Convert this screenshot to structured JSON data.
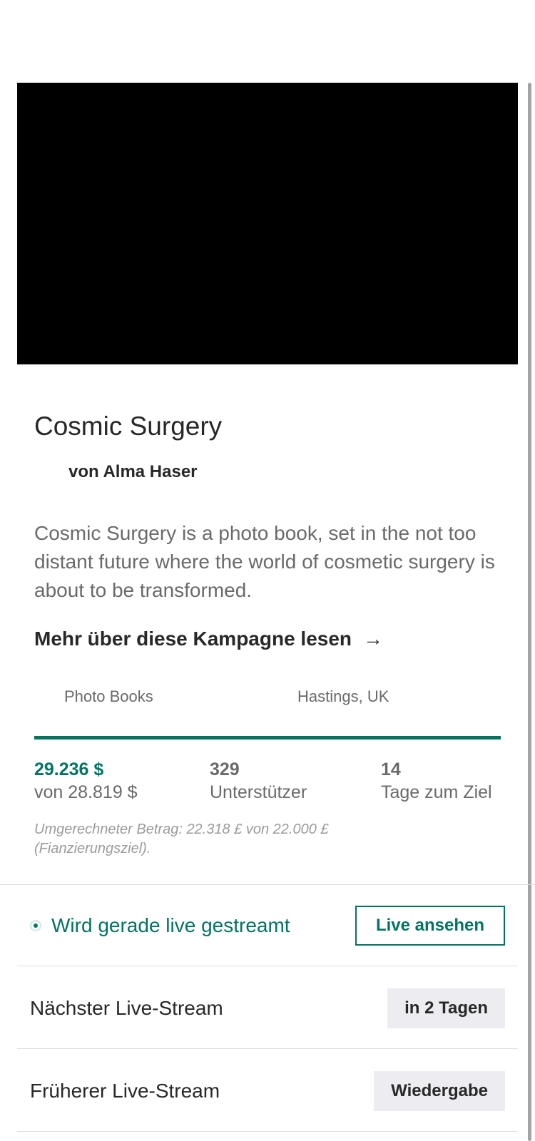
{
  "project": {
    "title": "Cosmic Surgery",
    "creator": "von Alma Haser",
    "blurb": "Cosmic Surgery is a photo book, set in the not too distant future where the world of cosmetic surgery is about to be transformed.",
    "read_more": "Mehr über diese Kampagne lesen",
    "category": "Photo Books",
    "location": "Hastings, UK"
  },
  "funding": {
    "progress_fraction": 1.0,
    "pledged": "29.236 $",
    "goal": "von 28.819 $",
    "backers_count": "329",
    "backers_label": "Unterstützer",
    "days_count": "14",
    "days_label": "Tage zum Ziel",
    "converted_note": "Umgerechneter Betrag: 22.318 £ von 22.000 £ (Fianzierungsziel)."
  },
  "live": {
    "now_status": "Wird gerade live gestreamt",
    "watch_button": "Live ansehen",
    "next_label": "Nächster Live-Stream",
    "next_value": "in 2 Tagen",
    "past_label": "Früherer Live-Stream",
    "past_button": "Wiedergabe"
  },
  "icons": {
    "read_more_arrow": "arrow-right-icon",
    "live_indicator": "live-dot-icon"
  },
  "colors": {
    "accent": "#037362",
    "text": "#282828",
    "muted": "#6a6a6a",
    "pill_bg": "#ededf1"
  }
}
